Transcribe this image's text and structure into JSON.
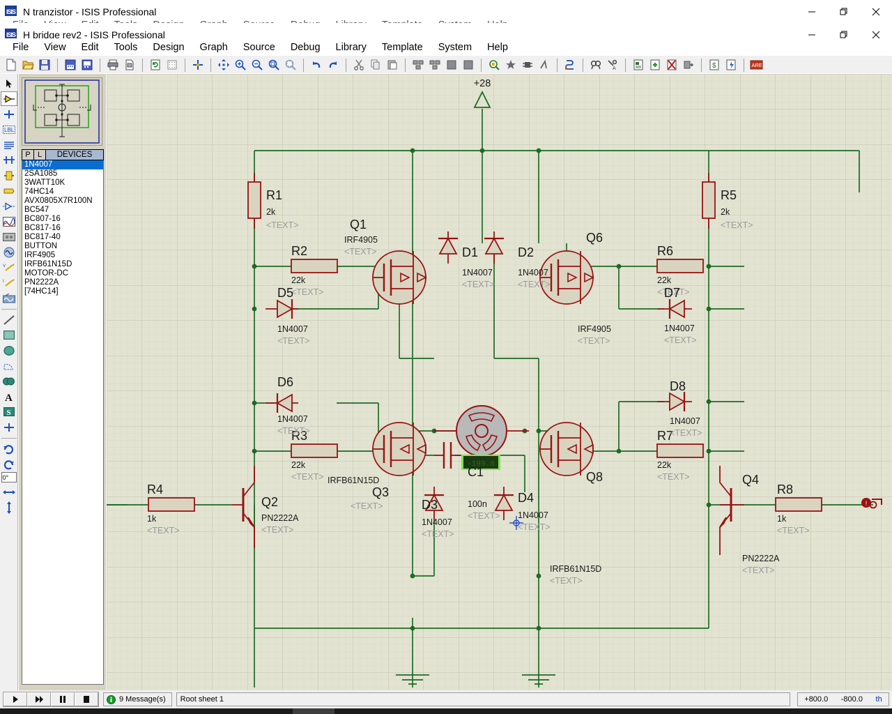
{
  "windows": {
    "background": {
      "title": "N tranzistor - ISIS Professional",
      "icon": "isis-app-icon",
      "menus": [
        "File",
        "View",
        "Edit",
        "Tools",
        "Design",
        "Graph",
        "Source",
        "Debug",
        "Library",
        "Template",
        "System",
        "Help"
      ],
      "controls": {
        "minimize": "minimize-icon",
        "restore": "restore-icon",
        "close": "close-icon"
      }
    },
    "foreground": {
      "title": "H bridge rev2 - ISIS Professional",
      "icon": "isis-app-icon",
      "menus": [
        "File",
        "View",
        "Edit",
        "Tools",
        "Design",
        "Graph",
        "Source",
        "Debug",
        "Library",
        "Template",
        "System",
        "Help"
      ],
      "controls": {
        "minimize": "minimize-icon",
        "restore": "restore-icon",
        "close": "close-icon"
      }
    }
  },
  "toolbar": {
    "groups": [
      [
        "new-file-icon",
        "open-file-icon",
        "save-file-icon"
      ],
      [
        "import-section-icon",
        "export-section-icon"
      ],
      [
        "print-icon",
        "print-area-icon"
      ],
      [
        "refresh-display-icon",
        "toggle-grid-icon"
      ],
      [
        "origin-icon"
      ],
      [
        "pan-icon",
        "zoom-in-icon",
        "zoom-out-icon",
        "zoom-all-icon",
        "zoom-area-icon"
      ],
      [
        "undo-icon",
        "redo-icon"
      ],
      [
        "cut-icon",
        "copy-icon",
        "paste-icon"
      ],
      [
        "block-copy-icon",
        "block-move-icon",
        "block-rotate-icon",
        "block-delete-icon"
      ],
      [
        "pick-device-icon",
        "make-device-icon",
        "packaging-tool-icon",
        "decompose-icon"
      ],
      [
        "wire-autorouter-icon"
      ],
      [
        "search-tag-icon",
        "property-assignment-icon"
      ],
      [
        "design-explorer-icon",
        "new-sheet-icon",
        "remove-sheet-icon",
        "exit-sheet-icon"
      ],
      [
        "bill-of-materials-icon",
        "electrical-rule-check-icon"
      ],
      [
        "netlist-ares-icon"
      ]
    ]
  },
  "left_tools": {
    "items": [
      {
        "name": "selection-mode",
        "icon": "arrow-cursor-icon",
        "selected": false
      },
      {
        "name": "component-mode",
        "icon": "component-icon",
        "selected": true
      },
      {
        "name": "junction-dot-mode",
        "icon": "junction-dot-icon",
        "selected": false
      },
      {
        "name": "wire-label-mode",
        "icon": "label-lbl-icon",
        "selected": false
      },
      {
        "name": "text-script-mode",
        "icon": "text-script-icon",
        "selected": false
      },
      {
        "name": "buses-mode",
        "icon": "bus-icon",
        "selected": false
      },
      {
        "name": "subcircuit-mode",
        "icon": "subcircuit-icon",
        "selected": false
      },
      {
        "name": "terminals-mode",
        "icon": "terminal-icon",
        "selected": false
      },
      {
        "name": "device-pins-mode",
        "icon": "device-pin-icon",
        "selected": false
      },
      {
        "name": "graph-mode",
        "icon": "graph-icon",
        "selected": false
      },
      {
        "name": "tape-recorder-mode",
        "icon": "tape-recorder-icon",
        "selected": false
      },
      {
        "name": "generator-mode",
        "icon": "generator-sine-icon",
        "selected": false
      },
      {
        "name": "voltage-probe-mode",
        "icon": "voltage-probe-icon",
        "selected": false
      },
      {
        "name": "current-probe-mode",
        "icon": "current-probe-icon",
        "selected": false
      },
      {
        "name": "virtual-instruments-mode",
        "icon": "oscilloscope-icon",
        "selected": false
      },
      {
        "name": "line-tool",
        "icon": "line-icon",
        "selected": false
      },
      {
        "name": "box-tool",
        "icon": "rectangle-icon",
        "selected": false
      },
      {
        "name": "circle-tool",
        "icon": "circle-icon",
        "selected": false
      },
      {
        "name": "arc-tool",
        "icon": "arc-icon",
        "selected": false
      },
      {
        "name": "path-tool",
        "icon": "closed-path-icon",
        "selected": false
      },
      {
        "name": "text-tool",
        "icon": "letter-a-icon",
        "selected": false
      },
      {
        "name": "symbol-tool",
        "icon": "symbol-s-icon",
        "selected": false
      },
      {
        "name": "marker-tool",
        "icon": "origin-marker-icon",
        "selected": false
      }
    ],
    "rotate_cw": "rotate-clockwise-icon",
    "rotate_ccw": "rotate-counterclockwise-icon",
    "rotation_value": "0°",
    "mirror_x": "mirror-horizontal-icon",
    "mirror_y": "mirror-vertical-icon"
  },
  "object_selector": {
    "preview_label": "component-preview",
    "tabs": [
      "P",
      "L"
    ],
    "header": "DEVICES",
    "devices": [
      "1N4007",
      "2SA1085",
      "3WATT10K",
      "74HC14",
      "AVX0805X7R100N",
      "BC547",
      "BC807-16",
      "BC817-16",
      "BC817-40",
      "BUTTON",
      "IRF4905",
      "IRFB61N15D",
      "MOTOR-DC",
      "PN2222A",
      "[74HC14]"
    ],
    "selected_device": "1N4007"
  },
  "schematic": {
    "power_terminal": "+28",
    "motor_display": "-199.8",
    "components": [
      {
        "ref": "R1",
        "value": "2k",
        "text": "<TEXT>",
        "type": "resistor-vertical"
      },
      {
        "ref": "R2",
        "value": "22k",
        "text": "<TEXT>",
        "type": "resistor-horizontal"
      },
      {
        "ref": "R3",
        "value": "22k",
        "text": "<TEXT>",
        "type": "resistor-horizontal"
      },
      {
        "ref": "R4",
        "value": "1k",
        "text": "<TEXT>",
        "type": "resistor-horizontal"
      },
      {
        "ref": "R5",
        "value": "2k",
        "text": "<TEXT>",
        "type": "resistor-vertical"
      },
      {
        "ref": "R6",
        "value": "22k",
        "text": "<TEXT>",
        "type": "resistor-horizontal"
      },
      {
        "ref": "R7",
        "value": "22k",
        "text": "<TEXT>",
        "type": "resistor-horizontal"
      },
      {
        "ref": "R8",
        "value": "1k",
        "text": "<TEXT>",
        "type": "resistor-horizontal"
      },
      {
        "ref": "D1",
        "value": "1N4007",
        "text": "<TEXT>",
        "type": "diode-up"
      },
      {
        "ref": "D2",
        "value": "1N4007",
        "text": "<TEXT>",
        "type": "diode-up"
      },
      {
        "ref": "D3",
        "value": "1N4007",
        "text": "<TEXT>",
        "type": "diode-up"
      },
      {
        "ref": "D4",
        "value": "1N4007",
        "text": "<TEXT>",
        "type": "diode-up"
      },
      {
        "ref": "D5",
        "value": "1N4007",
        "text": "<TEXT>",
        "type": "diode-right"
      },
      {
        "ref": "D6",
        "value": "1N4007",
        "text": "<TEXT>",
        "type": "diode-left"
      },
      {
        "ref": "D7",
        "value": "1N4007",
        "text": "<TEXT>",
        "type": "diode-left"
      },
      {
        "ref": "D8",
        "value": "1N4007",
        "text": "<TEXT>",
        "type": "diode-right"
      },
      {
        "ref": "Q1",
        "value": "IRF4905",
        "text": "<TEXT>",
        "type": "pmos"
      },
      {
        "ref": "Q2",
        "value": "PN2222A",
        "text": "<TEXT>",
        "type": "npn"
      },
      {
        "ref": "Q3",
        "value": "IRFB61N15D",
        "text": "<TEXT>",
        "type": "nmos"
      },
      {
        "ref": "Q4",
        "value": "PN2222A",
        "text": "<TEXT>",
        "type": "npn"
      },
      {
        "ref": "Q6",
        "value": "IRF4905",
        "text": "<TEXT>",
        "type": "pmos"
      },
      {
        "ref": "Q8",
        "value": "IRFB61N15D",
        "text": "<TEXT>",
        "type": "nmos"
      },
      {
        "ref": "C1",
        "value": "100n",
        "text": "<TEXT>",
        "type": "capacitor"
      }
    ]
  },
  "statusbar": {
    "sim_buttons": [
      {
        "name": "play-button",
        "icon": "play-icon"
      },
      {
        "name": "step-button",
        "icon": "step-icon"
      },
      {
        "name": "pause-button",
        "icon": "pause-icon"
      },
      {
        "name": "stop-button",
        "icon": "stop-icon"
      }
    ],
    "messages": "9 Message(s)",
    "message_icon": "info-icon",
    "sheet": "Root sheet 1",
    "coord_x": "+800.0",
    "coord_y": "-800.0",
    "coord_unit": "th"
  },
  "colors": {
    "wire_green": "#1d6b25",
    "component_red": "#991212",
    "canvas_bg": "#e3e3d2",
    "selection_blue": "#0a6ed1",
    "text_gray": "#9a9a9a"
  }
}
